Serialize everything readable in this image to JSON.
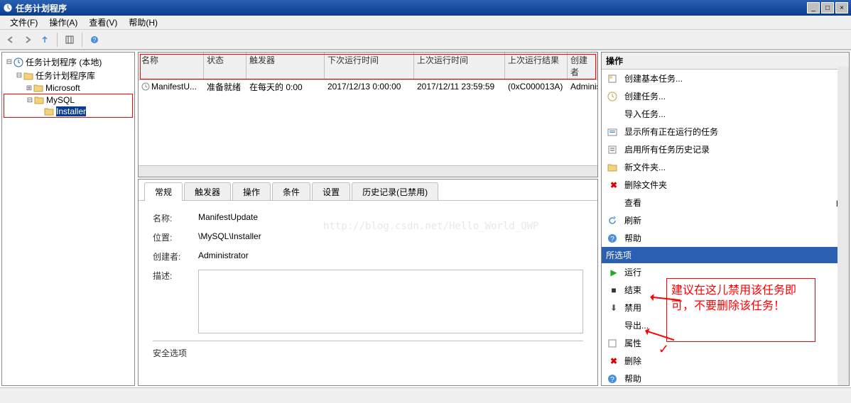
{
  "window": {
    "title": "任务计划程序"
  },
  "menu": {
    "file": "文件(F)",
    "action": "操作(A)",
    "view": "查看(V)",
    "help": "帮助(H)"
  },
  "tree": {
    "root": "任务计划程序 (本地)",
    "library": "任务计划程序库",
    "microsoft": "Microsoft",
    "mysql": "MySQL",
    "installer": "Installer"
  },
  "task_list": {
    "columns": {
      "name": "名称",
      "status": "状态",
      "triggers": "触发器",
      "next_run": "下次运行时间",
      "last_run": "上次运行时间",
      "last_result": "上次运行结果",
      "author": "创建者"
    },
    "row": {
      "name": "ManifestU...",
      "status": "准备就绪",
      "triggers": "在每天的 0:00",
      "next_run": "2017/12/13 0:00:00",
      "last_run": "2017/12/11 23:59:59",
      "last_result": "(0xC000013A)",
      "author": "Administ"
    }
  },
  "tabs": {
    "general": "常规",
    "triggers": "触发器",
    "actions": "操作",
    "conditions": "条件",
    "settings": "设置",
    "history": "历史记录(已禁用)"
  },
  "detail": {
    "name_label": "名称:",
    "name_value": "ManifestUpdate",
    "location_label": "位置:",
    "location_value": "\\MySQL\\Installer",
    "author_label": "创建者:",
    "author_value": "Administrator",
    "desc_label": "描述:",
    "security_section": "安全选项"
  },
  "watermark": "http://blog.csdn.net/Hello_World_QWP",
  "actions": {
    "title": "操作",
    "create_basic": "创建基本任务...",
    "create_task": "创建任务...",
    "import": "导入任务...",
    "show_running": "显示所有正在运行的任务",
    "enable_history": "启用所有任务历史记录",
    "new_folder": "新文件夹...",
    "delete_folder": "删除文件夹",
    "view": "查看",
    "refresh": "刷新",
    "help": "帮助",
    "selected_header": "所选项",
    "run": "运行",
    "end": "结束",
    "disable": "禁用",
    "export": "导出...",
    "properties": "属性",
    "delete": "删除",
    "help2": "帮助"
  },
  "annotation": "建议在这儿禁用该任务即可，不要删除该任务！"
}
